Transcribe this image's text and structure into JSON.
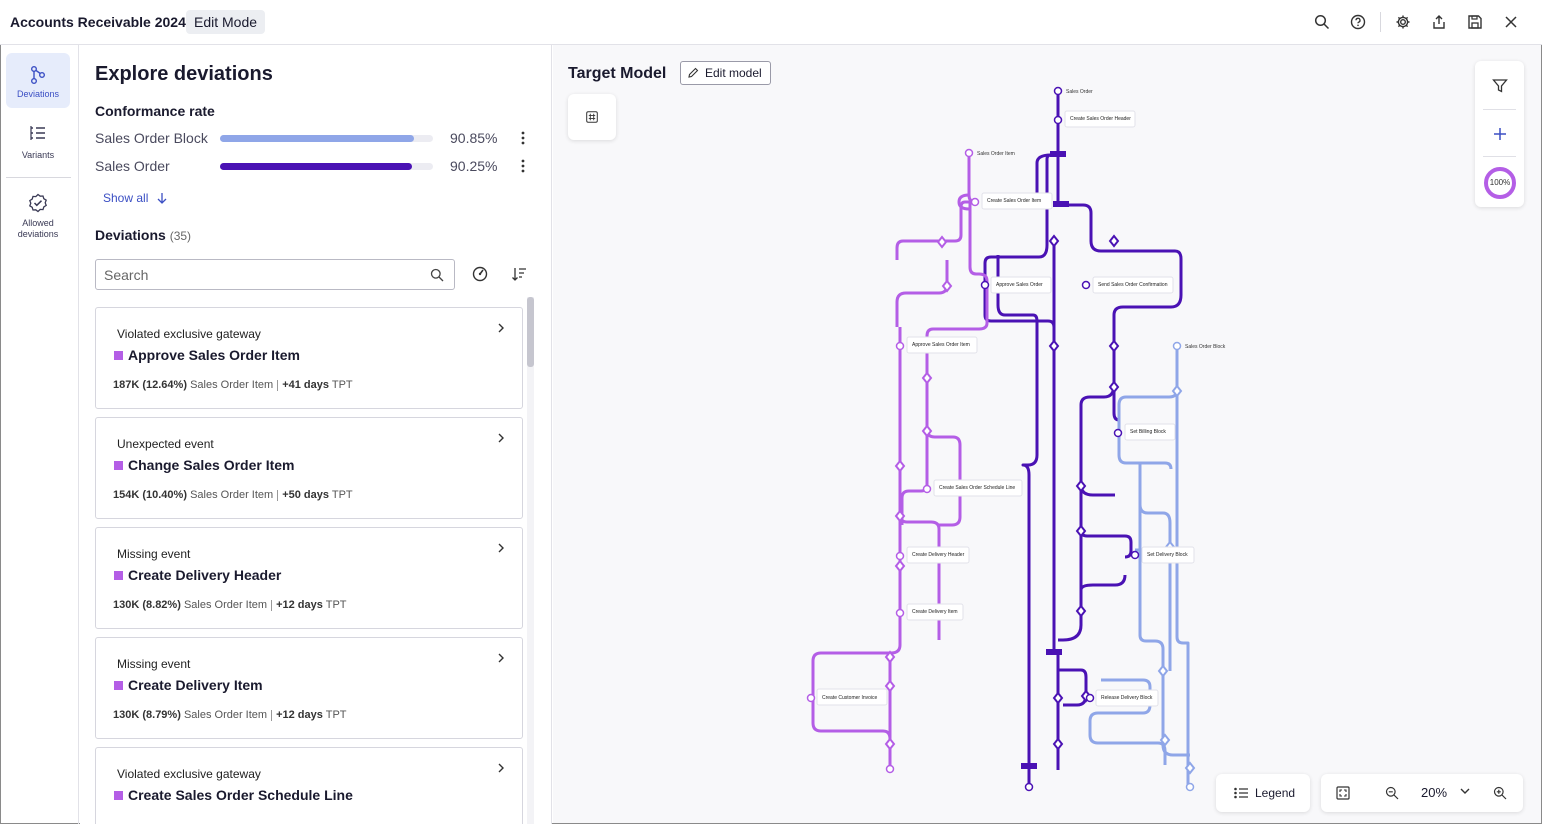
{
  "app": {
    "title": "Accounts Receivable 2024",
    "mode_badge": "Edit Mode"
  },
  "toolbar_icons": [
    "search-icon",
    "help-icon",
    "settings-icon",
    "share-icon",
    "save-icon",
    "close-icon"
  ],
  "nav": {
    "items": [
      {
        "label": "Deviations",
        "icon": "deviations-icon",
        "active": true
      },
      {
        "label": "Variants",
        "icon": "variants-icon",
        "active": false
      },
      {
        "label": "Allowed deviations",
        "icon": "allowed-deviations-icon",
        "active": false
      }
    ]
  },
  "panel": {
    "title": "Explore deviations",
    "conformance_title": "Conformance rate",
    "rates": [
      {
        "label": "Sales Order Block",
        "value": "90.85%",
        "fraction": 0.9085,
        "color": "#8fa6e8"
      },
      {
        "label": "Sales Order",
        "value": "90.25%",
        "fraction": 0.9025,
        "color": "#4a12b4"
      }
    ],
    "show_all": "Show all",
    "deviations_title": "Deviations",
    "deviations_count": "(35)",
    "search_placeholder": "Search",
    "cards": [
      {
        "type": "Violated exclusive gateway",
        "title": "Approve Sales Order Item",
        "count": "187K (12.64%)",
        "object": "Sales Order Item",
        "days": "+41 days",
        "unit": "TPT"
      },
      {
        "type": "Unexpected event",
        "title": "Change Sales Order Item",
        "count": "154K (10.40%)",
        "object": "Sales Order Item",
        "days": "+50 days",
        "unit": "TPT"
      },
      {
        "type": "Missing event",
        "title": "Create Delivery Header",
        "count": "130K (8.82%)",
        "object": "Sales Order Item",
        "days": "+12 days",
        "unit": "TPT"
      },
      {
        "type": "Missing event",
        "title": "Create Delivery Item",
        "count": "130K (8.79%)",
        "object": "Sales Order Item",
        "days": "+12 days",
        "unit": "TPT"
      },
      {
        "type": "Violated exclusive gateway",
        "title": "Create Sales Order Schedule Line",
        "count": "",
        "object": "",
        "days": "",
        "unit": ""
      }
    ]
  },
  "canvas": {
    "title": "Target Model",
    "edit_button": "Edit model",
    "zoom_badge": "100%",
    "legend_label": "Legend",
    "zoom_level": "20%",
    "colors": {
      "sales_order": "#4a12b4",
      "sales_order_item": "#b45ee6",
      "sales_order_block": "#8fa6e8"
    },
    "start_labels": {
      "sales_order": "Sales Order",
      "sales_order_item": "Sales Order Item",
      "sales_order_block": "Sales Order Block"
    },
    "activities": [
      "Create Sales Order Header",
      "Create Sales Order Item",
      "Approve Sales Order",
      "Send Sales Order Confirmation",
      "Approve Sales Order Item",
      "Set Billing Block",
      "Create Sales Order Schedule Line",
      "Create Delivery Header",
      "Set Delivery Block",
      "Create Delivery Item",
      "Create Customer Invoice",
      "Release Delivery Block"
    ]
  }
}
